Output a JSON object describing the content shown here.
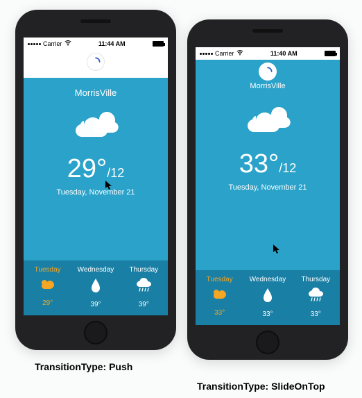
{
  "phones": {
    "left": {
      "status": {
        "carrier": "Carrier",
        "time": "11:44 AM",
        "wifi": "wifi-icon"
      },
      "location": "MorrisVille",
      "temp_hi": "29°",
      "temp_lo": "/12",
      "date": "Tuesday, November 21",
      "forecast": [
        {
          "name": "Tuesday",
          "temp": "29°",
          "icon": "cloud-sun",
          "selected": true
        },
        {
          "name": "Wednesday",
          "temp": "39°",
          "icon": "droplet",
          "selected": false
        },
        {
          "name": "Thursday",
          "temp": "39°",
          "icon": "rain",
          "selected": false
        }
      ]
    },
    "right": {
      "status": {
        "carrier": "Carrier",
        "time": "11:40 AM",
        "wifi": "wifi-icon"
      },
      "location": "MorrisVille",
      "temp_hi": "33°",
      "temp_lo": "/12",
      "date": "Tuesday, November 21",
      "forecast": [
        {
          "name": "Tuesday",
          "temp": "33°",
          "icon": "cloud-sun",
          "selected": true
        },
        {
          "name": "Wednesday",
          "temp": "33°",
          "icon": "droplet",
          "selected": false
        },
        {
          "name": "Thursday",
          "temp": "33°",
          "icon": "rain",
          "selected": false
        }
      ]
    }
  },
  "captions": {
    "left": "TransitionType: Push",
    "right": "TransitionType: SlideOnTop"
  },
  "colors": {
    "accent": "#2aa2c9",
    "forecast_bg": "#1a7fa4",
    "selected": "#f5a623"
  }
}
